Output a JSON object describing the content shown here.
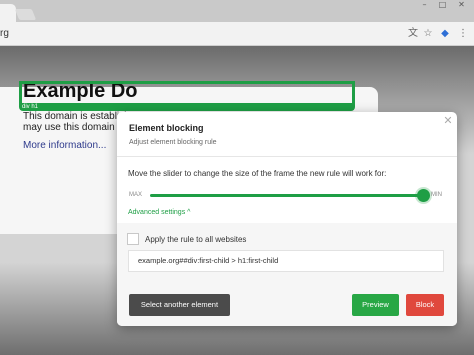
{
  "browser": {
    "url_fragment": "rg",
    "window_controls": [
      "–",
      "□",
      "✕"
    ]
  },
  "page": {
    "heading": "Example Do",
    "paragraph_line1": "This domain is establishe",
    "paragraph_line2": "may use this domain in e",
    "link": "More information...",
    "selection_tag": "div h1"
  },
  "dialog": {
    "title": "Element blocking",
    "subtitle": "Adjust element blocking rule",
    "close": "✕",
    "slider_description": "Move the slider to change the size of the frame the new rule will work for:",
    "slider_max_label": "MAX",
    "slider_min_label": "MIN",
    "slider_value": 1.0,
    "advanced_settings": "Advanced settings ^",
    "apply_all_label": "Apply the rule to all websites",
    "apply_all_checked": false,
    "rule_text": "example.org##div:first-child > h1:first-child",
    "buttons": {
      "select_another": "Select another element",
      "preview": "Preview",
      "block": "Block"
    }
  },
  "colors": {
    "accent_green": "#1e9e45",
    "preview_green": "#28a745",
    "block_red": "#e0483d",
    "dark_button": "#4b4b4b"
  }
}
